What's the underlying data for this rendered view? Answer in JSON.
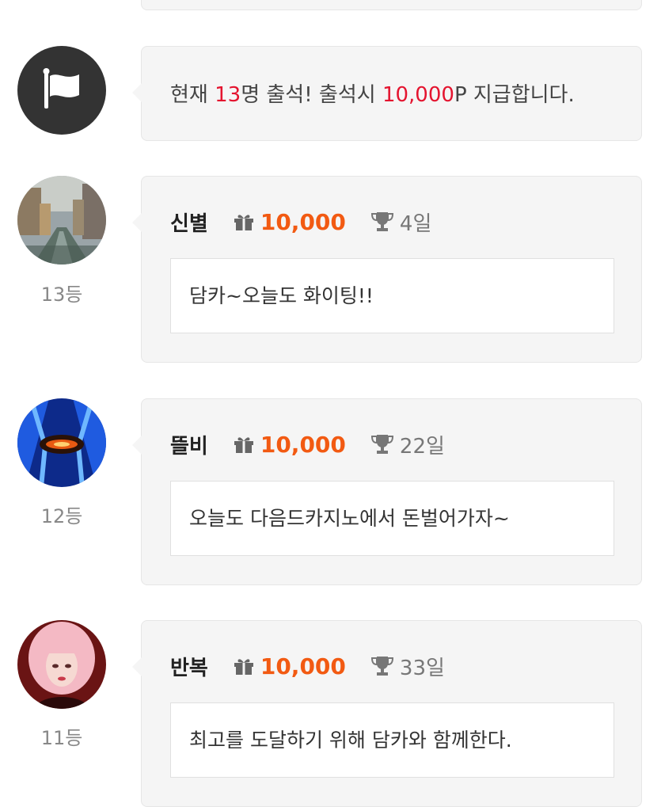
{
  "notice": {
    "prefix": "현재 ",
    "count": "13",
    "middle": "명 출석! 출석시 ",
    "amount": "10,000",
    "suffix": "P 지급합니다."
  },
  "entries": [
    {
      "nickname": "신별",
      "points": "10,000",
      "days": "4일",
      "message": "담카~오늘도 화이팅!!",
      "rank": "13등"
    },
    {
      "nickname": "뜰비",
      "points": "10,000",
      "days": "22일",
      "message": "오늘도 다음드카지노에서 돈벌어가자~",
      "rank": "12등"
    },
    {
      "nickname": "반복",
      "points": "10,000",
      "days": "33일",
      "message": "최고를 도달하기 위해 담카와 함께한다.",
      "rank": "11등"
    }
  ],
  "colors": {
    "highlight_red": "#e4142f",
    "points_orange": "#f25a12"
  }
}
